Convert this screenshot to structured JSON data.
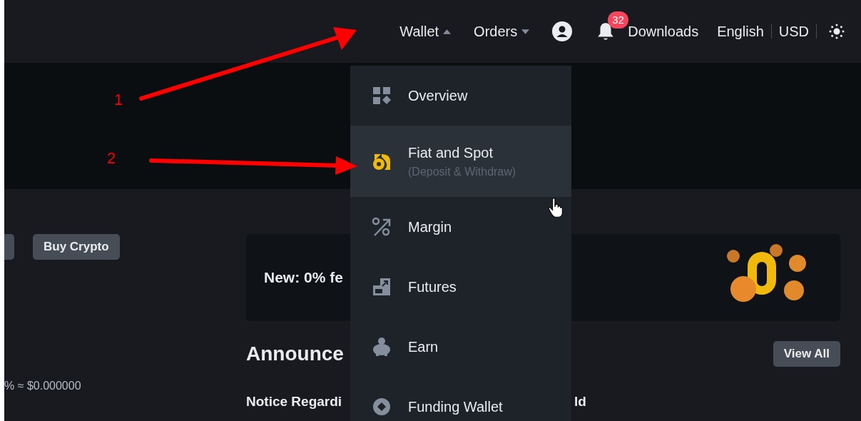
{
  "header": {
    "nav": [
      {
        "label": "Wallet",
        "expanded": true
      },
      {
        "label": "Orders",
        "expanded": false
      }
    ],
    "notification_count": "32",
    "downloads": "Downloads",
    "language": "English",
    "currency": "USD"
  },
  "left": {
    "buy_button": "Buy Crypto",
    "balance_text": "% ≈ $0.000000"
  },
  "promo": {
    "text": "New: 0% fe"
  },
  "announcements": {
    "title": "Announce",
    "view_all": "View All",
    "notice": "Notice Regardi",
    "notice_tail": "ld"
  },
  "wallet_menu": [
    {
      "label": "Overview",
      "selected": false
    },
    {
      "label": "Fiat and Spot",
      "sublabel": "(Deposit & Withdraw)",
      "selected": true
    },
    {
      "label": "Margin",
      "selected": false
    },
    {
      "label": "Futures",
      "selected": false
    },
    {
      "label": "Earn",
      "selected": false
    },
    {
      "label": "Funding Wallet",
      "selected": false
    }
  ],
  "annotations": [
    {
      "label": "1"
    },
    {
      "label": "2"
    }
  ]
}
